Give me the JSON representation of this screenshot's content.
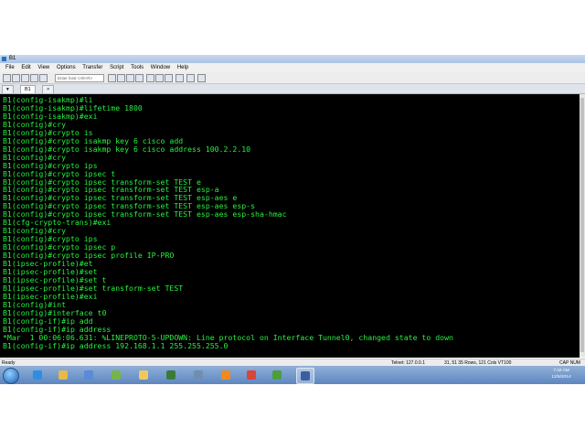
{
  "window": {
    "title": "B1"
  },
  "menu": [
    "File",
    "Edit",
    "View",
    "Options",
    "Transfer",
    "Script",
    "Tools",
    "Window",
    "Help"
  ],
  "toolbar": {
    "host_placeholder": "Enter host <Alt+R>"
  },
  "tabs": [
    {
      "label": "B1"
    }
  ],
  "terminal": {
    "lines": [
      "B1(config-isakmp)#li",
      "B1(config-isakmp)#lifetime 1800",
      "B1(config-isakmp)#exi",
      "B1(config)#cry",
      "B1(config)#crypto is",
      "B1(config)#crypto isakmp key 6 cisco add",
      "B1(config)#crypto isakmp key 6 cisco address 100.2.2.10",
      "B1(config)#cry",
      "B1(config)#crypto ips",
      "B1(config)#crypto ipsec t",
      "B1(config)#crypto ipsec transform-set TEST e",
      "B1(config)#crypto ipsec transform-set TEST esp-a",
      "B1(config)#crypto ipsec transform-set TEST esp-aes e",
      "B1(config)#crypto ipsec transform-set TEST esp-aes esp-s",
      "B1(config)#crypto ipsec transform-set TEST esp-aes esp-sha-hmac",
      "B1(cfg-crypto-trans)#exi",
      "B1(config)#cry",
      "B1(config)#crypto ips",
      "B1(config)#crypto ipsec p",
      "B1(config)#crypto ipsec profile IP-PRO",
      "B1(ipsec-profile)#et",
      "B1(ipsec-profile)#set",
      "B1(ipsec-profile)#set t",
      "B1(ipsec-profile)#set transform-set TEST",
      "B1(ipsec-profile)#exi",
      "B1(config)#int",
      "B1(config)#interface t0",
      "B1(config-if)#ip add",
      "B1(config-if)#ip address",
      "*Mar  1 00:06:06.631: %LINEPROTO-5-UPDOWN: Line protocol on Interface Tunnel0, changed state to down",
      "B1(config-if)#ip address 192.168.1.1 255.255.255.0"
    ]
  },
  "status": {
    "ready": "Ready",
    "telnet": "Telnet: 127.0.0.1",
    "position": "31, 51  35 Rows, 121 Cols  VT100",
    "cap": "CAP  NUM"
  },
  "clock": {
    "time": "7:42 AM",
    "date": "12/5/2014"
  },
  "taskbar": {
    "icons": [
      {
        "name": "ie-icon",
        "color": "#2f8ee0"
      },
      {
        "name": "folder-explorer-icon",
        "color": "#e8b84a"
      },
      {
        "name": "network-icon",
        "color": "#5a8bd6"
      },
      {
        "name": "image-viewer-icon",
        "color": "#76b44b"
      },
      {
        "name": "folder-icon",
        "color": "#f0c860"
      },
      {
        "name": "monitor-icon",
        "color": "#3c7a3c"
      },
      {
        "name": "terminal-app-icon",
        "color": "#6f8fb0"
      },
      {
        "name": "vlc-icon",
        "color": "#f08a1c"
      },
      {
        "name": "paint-icon",
        "color": "#d8453a"
      },
      {
        "name": "media-icon",
        "color": "#4d9d3d"
      },
      {
        "name": "securecrt-icon",
        "color": "#3a5fa0"
      }
    ]
  }
}
